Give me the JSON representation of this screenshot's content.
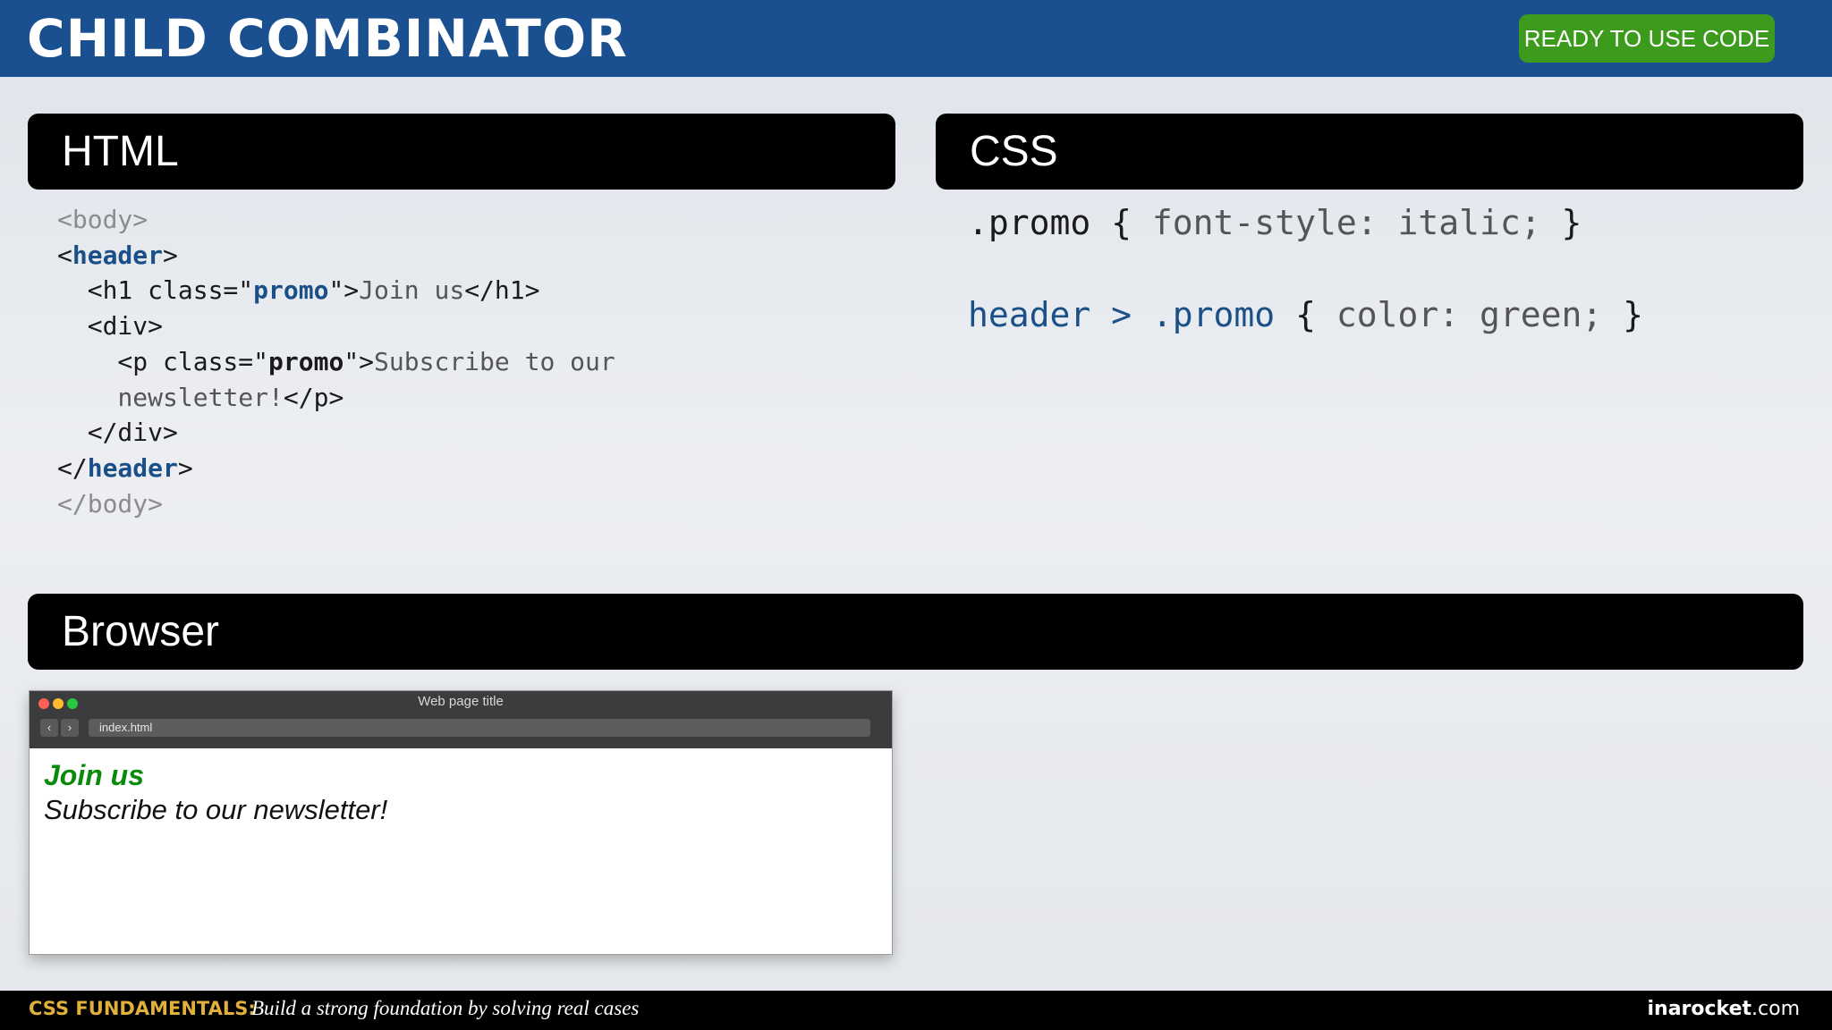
{
  "header": {
    "title": "CHILD COMBINATOR",
    "ready_button": "READY TO USE CODE"
  },
  "html_panel": {
    "title": "HTML",
    "code": {
      "body_open": "<body>",
      "header_lt": "<",
      "header_tag": "header",
      "header_gt": ">",
      "h1_pre": "  <h1 class=\"",
      "h1_class": "promo",
      "h1_mid": "\">",
      "h1_text": "Join us",
      "h1_close": "</h1>",
      "div_open": "  <div>",
      "p_pre": "    <p class=\"",
      "p_class": "promo",
      "p_mid": "\">",
      "p_text1": "Subscribe to our",
      "p_text2": "newsletter!",
      "p_close": "</p>",
      "div_close": "  </div>",
      "header_close_lt": "</",
      "header_close_tag": "header",
      "header_close_gt": ">",
      "body_close": "</body>"
    }
  },
  "css_panel": {
    "title": "CSS",
    "rule1": {
      "selector": ".promo",
      "open": " { ",
      "declaration": "font-style: italic;",
      "close": " }"
    },
    "rule2": {
      "selector_a": "header",
      "combinator": " > ",
      "selector_b": ".promo",
      "open": " { ",
      "declaration": "color: green;",
      "close": " }"
    }
  },
  "browser_panel": {
    "title": "Browser",
    "window_title": "Web page title",
    "url": "index.html",
    "back_icon": "‹",
    "forward_icon": "›",
    "h1_text": "Join us",
    "p_text": "Subscribe to our newsletter!"
  },
  "footer": {
    "course": "CSS FUNDAMENTALS:",
    "tagline": "Build a strong foundation by solving real cases",
    "brand_bold": "inarocket",
    "brand_suffix": ".com"
  },
  "colors": {
    "header_bar": "#1a5090",
    "ready_button": "#3c9a1c",
    "code_keyword": "#1a5087",
    "promo_heading": "#0a8a0a",
    "footer_course": "#e0b03a",
    "traffic_red": "#ff5f57",
    "traffic_yellow": "#febc2e",
    "traffic_green": "#28c840"
  }
}
